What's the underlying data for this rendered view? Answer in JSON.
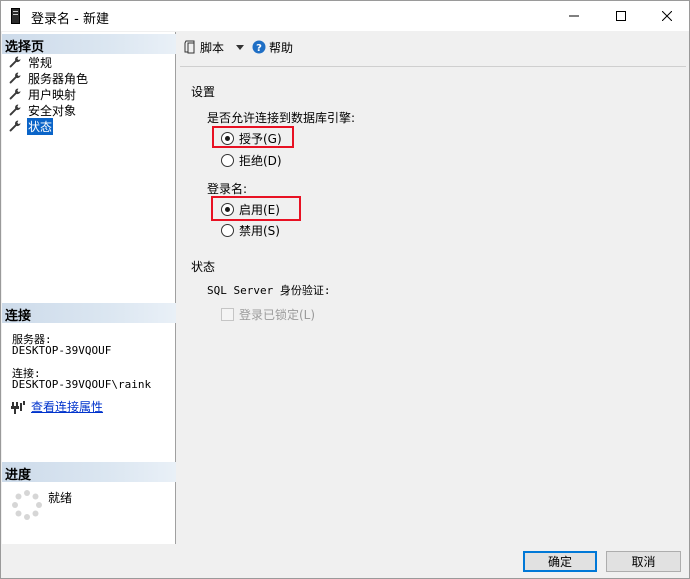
{
  "window": {
    "title": "登录名 - 新建",
    "controls": [
      "minimize-icon",
      "maximize-icon",
      "close-icon"
    ]
  },
  "left": {
    "select_page_header": "选择页",
    "pages": [
      {
        "label": "常规",
        "icon": "wrench-icon",
        "selected": false
      },
      {
        "label": "服务器角色",
        "icon": "wrench-icon",
        "selected": false
      },
      {
        "label": "用户映射",
        "icon": "wrench-icon",
        "selected": false
      },
      {
        "label": "安全对象",
        "icon": "wrench-icon",
        "selected": false
      },
      {
        "label": "状态",
        "icon": "wrench-icon",
        "selected": true
      }
    ],
    "connection_header": "连接",
    "server_label": "服务器:",
    "server_value": "DESKTOP-39VQOUF",
    "connection_label": "连接:",
    "connection_value": "DESKTOP-39VQOUF\\raink",
    "view_props_link": "查看连接属性",
    "progress_header": "进度",
    "progress_status": "就绪"
  },
  "toolbar": {
    "script_label": "脚本",
    "help_label": "帮助"
  },
  "settings": {
    "section_title": "设置",
    "db_engine_question": "是否允许连接到数据库引擎:",
    "grant_label": "授予(G)",
    "deny_label": "拒绝(D)",
    "grant_selected": true,
    "login_label": "登录名:",
    "enable_label": "启用(E)",
    "disable_label": "禁用(S)",
    "enable_selected": true
  },
  "status": {
    "section_title": "状态",
    "sql_auth_label": "SQL Server 身份验证:",
    "locked_label": "登录已锁定(L)",
    "locked_checked": false
  },
  "buttons": {
    "ok": "确定",
    "cancel": "取消"
  },
  "colors": {
    "selection_blue": "#0a64c8",
    "highlight_red": "#e81123",
    "link_blue": "#0033cc",
    "default_button_border": "#0078d7"
  }
}
